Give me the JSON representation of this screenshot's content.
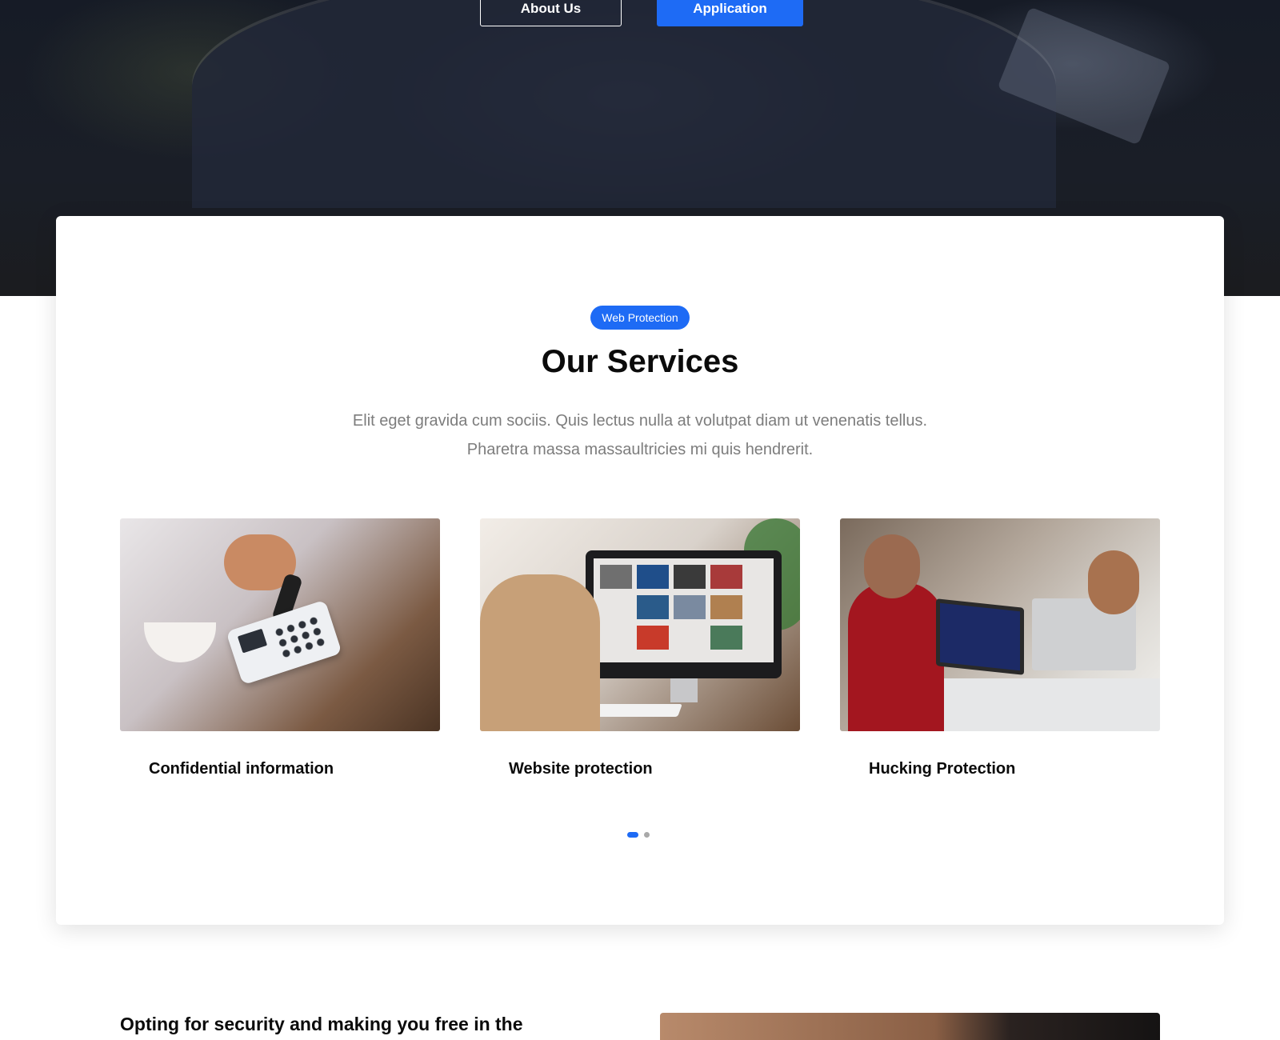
{
  "hero": {
    "about_button": "About Us",
    "application_button": "Application"
  },
  "services": {
    "badge": "Web Protection",
    "title": "Our Services",
    "description_line1": "Elit eget gravida cum sociis. Quis lectus nulla at volutpat diam ut venenatis tellus.",
    "description_line2": "Pharetra massa massaultricies mi quis hendrerit.",
    "items": [
      {
        "name": "Confidential information",
        "image": "card-payment-terminal-photo"
      },
      {
        "name": "Website protection",
        "image": "woman-at-computer-monitor-photo"
      },
      {
        "name": "Hucking Protection",
        "image": "developers-at-laptops-photo"
      }
    ],
    "pagination": {
      "pages": 2,
      "active": 1
    }
  },
  "bottom": {
    "title": "Opting for security and making you free in the"
  },
  "colors": {
    "accent": "#1e6bf5",
    "hero_bg": "#1b1c1f",
    "text_dark": "#0b0b0b",
    "text_muted": "#7d7d7d"
  }
}
